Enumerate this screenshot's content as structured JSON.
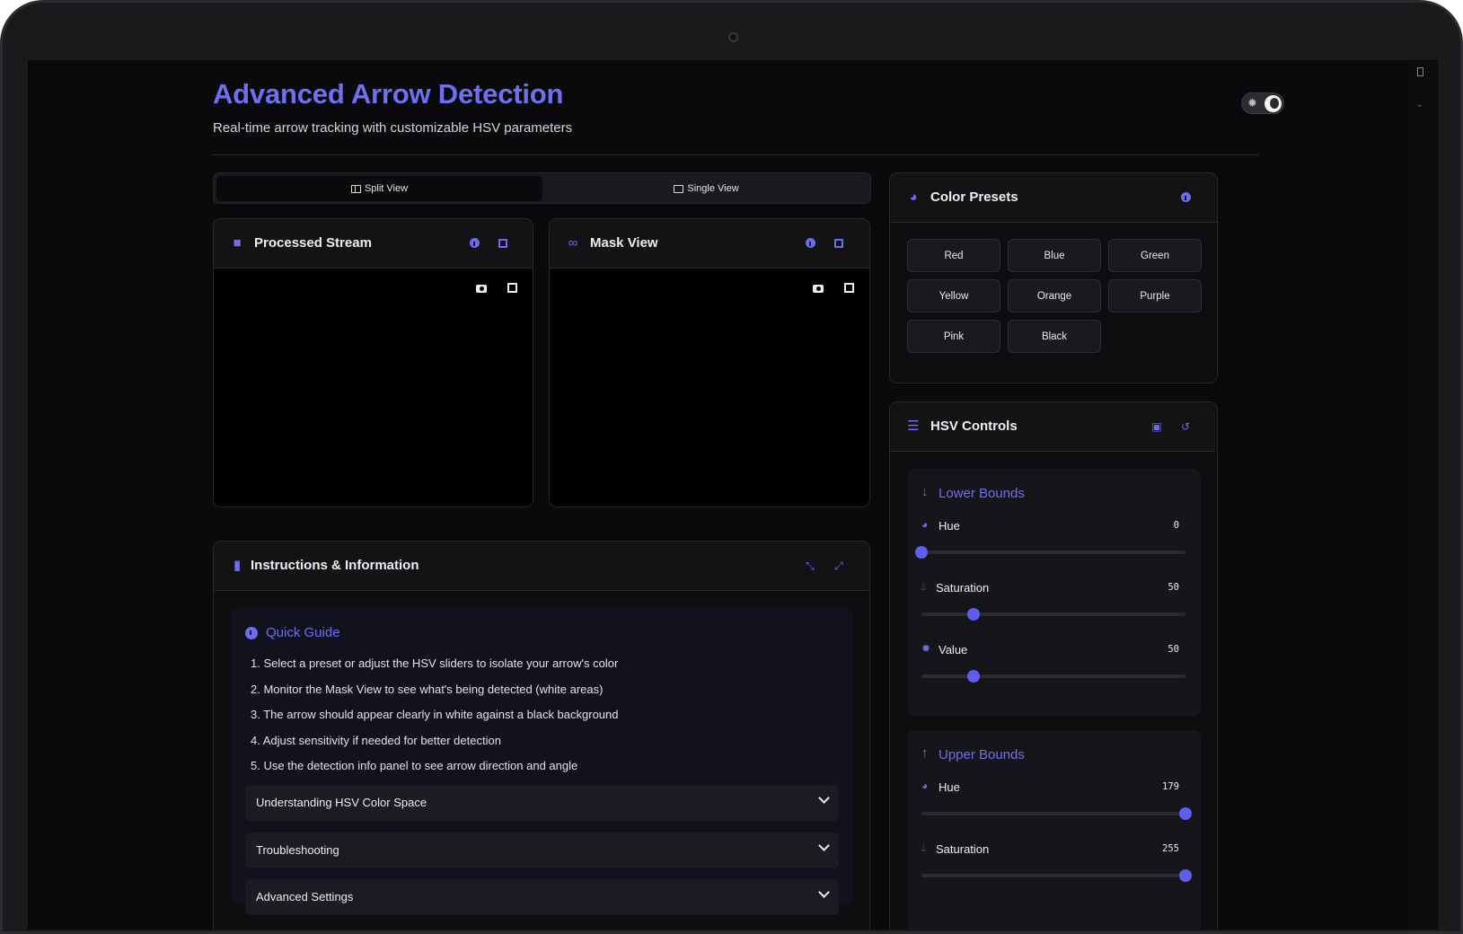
{
  "header": {
    "title": "Advanced Arrow Detection",
    "subtitle": "Real-time arrow tracking with customizable HSV parameters"
  },
  "view_tabs": {
    "split_label": "Split View",
    "single_label": "Single View",
    "active": "split"
  },
  "streams": {
    "processed_title": "Processed Stream",
    "mask_title": "Mask View"
  },
  "instructions": {
    "title": "Instructions & Information",
    "guide_title": "Quick Guide",
    "steps": [
      "1. Select a preset or adjust the HSV sliders to isolate your arrow's color",
      "2. Monitor the Mask View to see what's being detected (white areas)",
      "3. The arrow should appear clearly in white against a black background",
      "4. Adjust sensitivity if needed for better detection",
      "5. Use the detection info panel to see arrow direction and angle"
    ],
    "accordions": [
      "Understanding HSV Color Space",
      "Troubleshooting",
      "Advanced Settings"
    ]
  },
  "presets": {
    "title": "Color Presets",
    "buttons": [
      "Red",
      "Blue",
      "Green",
      "Yellow",
      "Orange",
      "Purple",
      "Pink",
      "Black"
    ]
  },
  "hsv": {
    "title": "HSV Controls",
    "lower": {
      "title": "Lower Bounds",
      "hue_label": "Hue",
      "hue": 0,
      "sat_label": "Saturation",
      "sat": 50,
      "val_label": "Value",
      "val": 50
    },
    "upper": {
      "title": "Upper Bounds",
      "hue_label": "Hue",
      "hue": 179,
      "sat_label": "Saturation",
      "sat": 255
    }
  },
  "colors": {
    "accent": "#6f6ff2",
    "background": "#0a0a0c",
    "card": "#0e0e11"
  },
  "icons": {
    "theme": "sun-icon",
    "processed": "video-camera-icon",
    "mask": "mask-icon",
    "instructions": "book-icon",
    "presets": "palette-icon",
    "hsv": "sliders-icon"
  }
}
